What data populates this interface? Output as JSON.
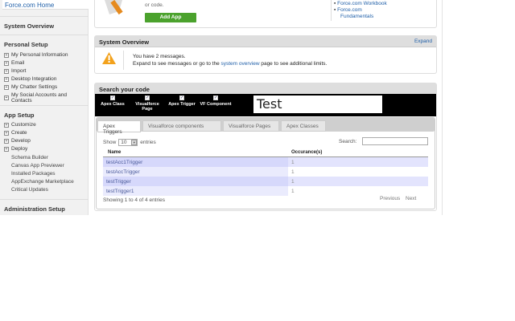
{
  "sidebar": {
    "home": "Force.com Home",
    "system_overview": "System Overview",
    "personal_setup": "Personal Setup",
    "personal_items": [
      "My Personal Information",
      "Email",
      "Import",
      "Desktop Integration",
      "My Chatter Settings",
      "My Social Accounts and Contacts"
    ],
    "app_setup": "App Setup",
    "app_items": [
      "Customize",
      "Create",
      "Develop",
      "Deploy"
    ],
    "app_sub_items": [
      "Schema Builder",
      "Canvas App Previewer",
      "Installed Packages",
      "AppExchange Marketplace",
      "Critical Updates"
    ],
    "admin_setup": "Administration Setup"
  },
  "top_card": {
    "text": "or code.",
    "add_app": "Add App",
    "links": [
      "Force.com Workbook",
      "Force.com",
      "Fundamentals"
    ]
  },
  "system_overview": {
    "title": "System Overview",
    "expand": "Expand",
    "line1": "You have 2 messages.",
    "line2_pre": "Expand to see messages or go to the ",
    "line2_link": "system overview",
    "line2_post": " page to see additional limits."
  },
  "search": {
    "title": "Search your code",
    "checkboxes": [
      {
        "label": "Apex Class",
        "checked": true
      },
      {
        "label": "Visualforce Page",
        "checked": true
      },
      {
        "label": "Apex Trigger",
        "checked": true
      },
      {
        "label": "VF Component",
        "checked": true
      }
    ],
    "query": "Test",
    "tabs": [
      "Apex Triggers",
      "Visualforce components",
      "Visualforce Pages",
      "Apex Classes"
    ],
    "active_tab": "Apex Triggers",
    "show": "Show",
    "entries_value": "10",
    "entries": "entries",
    "search_label": "Search:",
    "search_value": "",
    "columns": [
      "Name",
      "Occurance(s)"
    ],
    "rows": [
      [
        "testAcc1Trigger",
        "1"
      ],
      [
        "testAccTrigger",
        "1"
      ],
      [
        "testTrigger",
        "1"
      ],
      [
        "testTrigger1",
        "1"
      ]
    ],
    "info": "Showing 1 to 4 of 4 entries",
    "previous": "Previous",
    "next": "Next"
  },
  "colors": {
    "accent": "#1f5fa8",
    "button": "#4ba22d",
    "row_odd": "#d6d8fb",
    "row_even": "#eaebfd"
  }
}
